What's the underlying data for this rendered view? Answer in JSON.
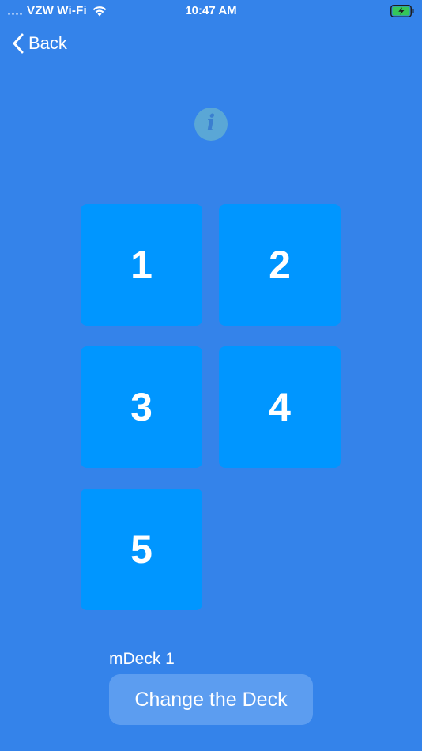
{
  "status_bar": {
    "carrier": "VZW Wi-Fi",
    "time": "10:47 AM",
    "battery_color": "#34C759"
  },
  "nav": {
    "back_label": "Back"
  },
  "info": {
    "glyph": "i",
    "icon": "info-icon"
  },
  "tiles": [
    "1",
    "2",
    "3",
    "4",
    "5"
  ],
  "deck": {
    "name": "mDeck 1",
    "change_label": "Change the Deck"
  },
  "colors": {
    "background": "#3483EA",
    "tile": "#0096FF",
    "info_circle": "#5AA7D6",
    "button": "#5C9DF0"
  }
}
